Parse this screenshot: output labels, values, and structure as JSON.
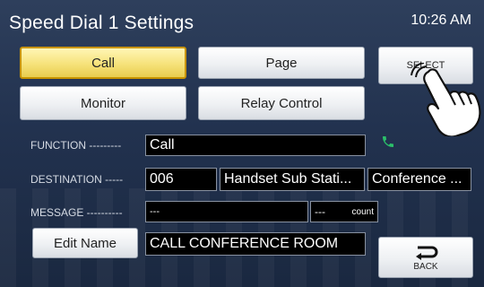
{
  "header": {
    "title": "Speed Dial 1 Settings",
    "time": "10:26 AM"
  },
  "buttons": {
    "call": "Call",
    "page": "Page",
    "monitor": "Monitor",
    "relay": "Relay Control",
    "select": "SELECT",
    "edit_name": "Edit Name",
    "back": "BACK"
  },
  "fields": {
    "function_label": "FUNCTION ---------",
    "function_value": "Call",
    "destination_label": "DESTINATION -----",
    "destination_number": "006",
    "destination_station": "Handset Sub Stati...",
    "destination_name": "Conference ...",
    "message_label": "MESSAGE ----------",
    "message_value": "---",
    "count_value": "---",
    "count_unit": "count",
    "name_value": "CALL CONFERENCE ROOM"
  },
  "colors": {
    "active_button": "#f6e27a",
    "phone_icon": "#2bbf6a",
    "background": "#22324f"
  },
  "icons": {
    "status": "phone-icon",
    "back": "back-arrow-icon",
    "pointer": "hand-pointer-icon"
  }
}
